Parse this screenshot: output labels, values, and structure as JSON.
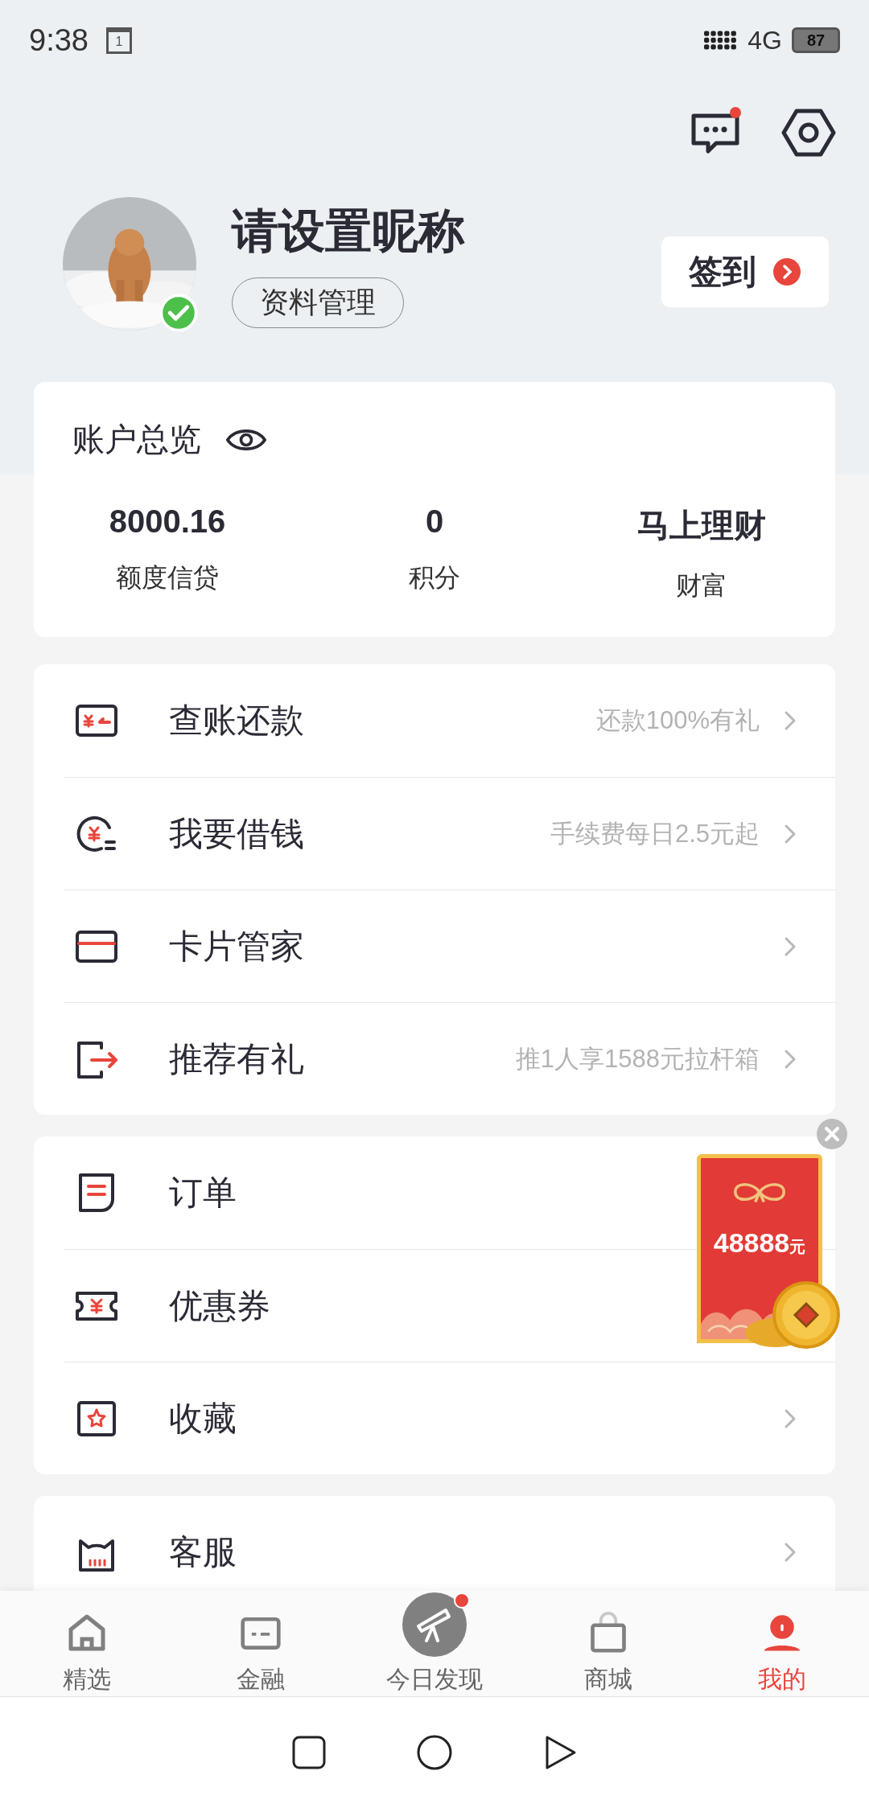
{
  "status_bar": {
    "time": "9:38",
    "calendar_day": "1",
    "network": "4G",
    "battery": "87"
  },
  "header": {
    "messages_unread": true
  },
  "profile": {
    "nickname": "请设置昵称",
    "manage_label": "资料管理",
    "verified": true,
    "checkin_label": "签到"
  },
  "account_overview": {
    "title": "账户总览",
    "stats": [
      {
        "value": "8000.16",
        "label": "额度信贷"
      },
      {
        "value": "0",
        "label": "积分"
      },
      {
        "value": "马上理财",
        "label": "财富"
      }
    ]
  },
  "menu_groups": [
    {
      "items": [
        {
          "label": "查账还款",
          "hint": "还款100%有礼"
        },
        {
          "label": "我要借钱",
          "hint": "手续费每日2.5元起"
        },
        {
          "label": "卡片管家"
        },
        {
          "label": "推荐有礼",
          "hint": "推1人享1588元拉杆箱"
        }
      ]
    },
    {
      "items": [
        {
          "label": "订单",
          "chevron": false
        },
        {
          "label": "优惠券",
          "chevron": false
        },
        {
          "label": "收藏"
        }
      ]
    },
    {
      "items": [
        {
          "label": "客服"
        }
      ]
    }
  ],
  "red_packet": {
    "amount": "48888",
    "unit": "元"
  },
  "tabs": [
    {
      "label": "精选",
      "selected": false,
      "dot": false
    },
    {
      "label": "金融",
      "selected": false,
      "dot": false
    },
    {
      "label": "今日发现",
      "selected": false,
      "dot": true
    },
    {
      "label": "商城",
      "selected": false,
      "dot": false
    },
    {
      "label": "我的",
      "selected": true,
      "dot": false
    }
  ]
}
